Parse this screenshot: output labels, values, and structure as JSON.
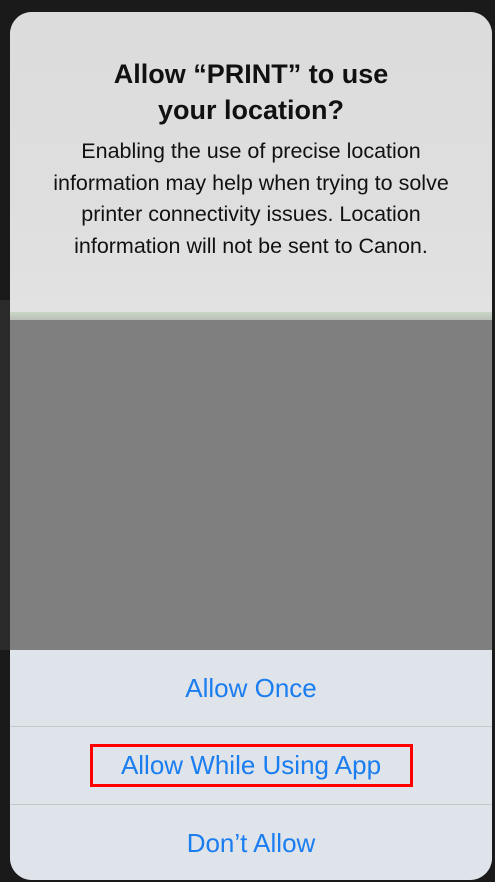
{
  "dialog": {
    "title": "Allow “PRINT” to use\nyour location?",
    "message": "Enabling the use of precise location information may help when trying to solve printer connectivity issues. Location information will not be sent to Canon."
  },
  "buttons": {
    "allow_once": "Allow Once",
    "allow_while_using": "Allow While Using App",
    "dont_allow": "Don’t Allow"
  },
  "colors": {
    "button_text": "#1a7df0",
    "highlight": "#ff0000",
    "redacted": "#7f7f7f"
  }
}
